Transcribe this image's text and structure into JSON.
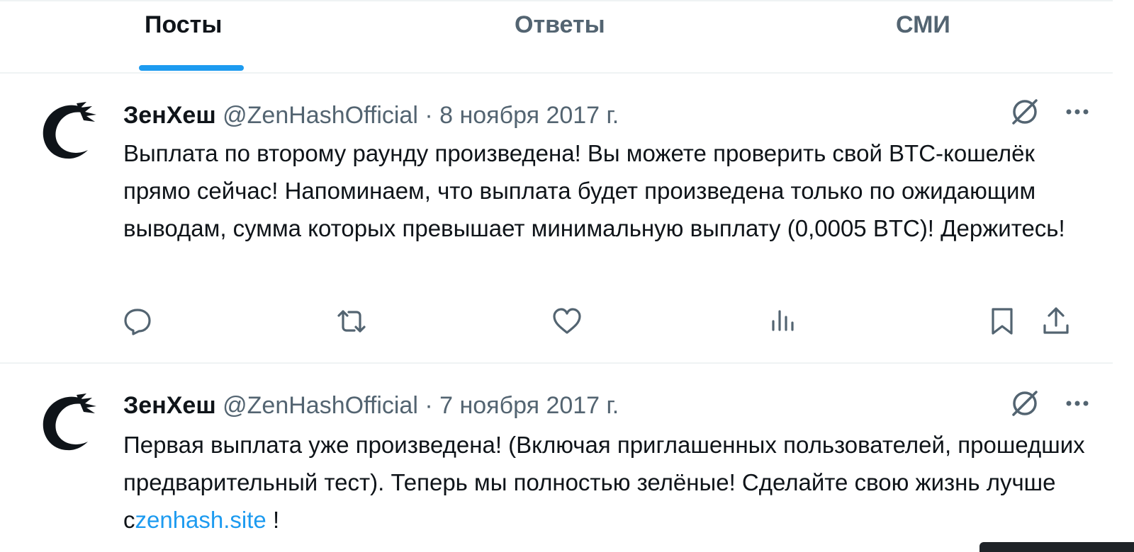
{
  "tabs": [
    {
      "label": "Посты",
      "active": true
    },
    {
      "label": "Ответы",
      "active": false
    },
    {
      "label": "СМИ",
      "active": false
    }
  ],
  "tweets": [
    {
      "name": "ЗенХеш",
      "handle": "@ZenHashOfficial",
      "separator": "·",
      "date": "8 ноября 2017 г.",
      "text": "Выплата по второму раунду произведена! Вы можете проверить свой BTC-кошелёк прямо сейчас! Напоминаем, что выплата будет произведена только по ожидающим выводам, сумма которых превышает минимальную выплату (0,0005 BTC)! Держитесь!",
      "actions": [
        "reply-icon",
        "retweet-icon",
        "like-icon",
        "views-icon",
        "bookmark-icon",
        "share-icon"
      ]
    },
    {
      "name": "ЗенХеш",
      "handle": "@ZenHashOfficial",
      "separator": "·",
      "date": "7 ноября 2017 г.",
      "text_before_link": "Первая выплата уже произведена! (Включая приглашенных пользователей, прошедших предварительный тест). Теперь мы полностью зелёные! Сделайте свою жизнь лучше с",
      "link": "zenhash.site",
      "text_after_link": " !"
    }
  ],
  "colors": {
    "accent": "#1d9bf0",
    "text_primary": "#0f1419",
    "text_secondary": "#536471",
    "border": "#eff3f4"
  }
}
